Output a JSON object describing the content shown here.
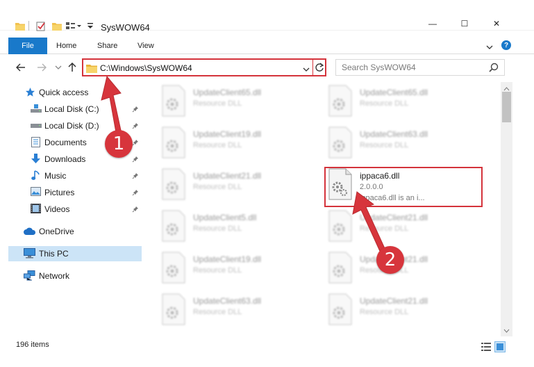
{
  "window": {
    "title": "SysWOW64",
    "minimize_glyph": "—",
    "maximize_glyph": "☐",
    "close_glyph": "✕"
  },
  "ribbon": {
    "tabs": [
      "File",
      "Home",
      "Share",
      "View"
    ],
    "help_glyph": "?"
  },
  "address": {
    "path": "C:\\Windows\\SysWOW64",
    "search_placeholder": "Search SysWOW64"
  },
  "nav": {
    "quick_access": "Quick access",
    "items": [
      "Local Disk (C:)",
      "Local Disk (D:)",
      "Documents",
      "Downloads",
      "Music",
      "Pictures",
      "Videos"
    ],
    "onedrive": "OneDrive",
    "this_pc": "This PC",
    "network": "Network"
  },
  "files": {
    "left": [
      {
        "name": "UpdateClient65.dll",
        "type": "Resource DLL"
      },
      {
        "name": "UpdateClient19.dll",
        "type": "Resource DLL"
      },
      {
        "name": "UpdateClient21.dll",
        "type": "Resource DLL"
      },
      {
        "name": "UpdateClient5.dll",
        "type": "Resource DLL"
      },
      {
        "name": "UpdateClient19.dll",
        "type": "Resource DLL"
      },
      {
        "name": "UpdateClient63.dll",
        "type": "Resource DLL"
      }
    ],
    "right": [
      {
        "name": "UpdateClient65.dll",
        "type": "Resource DLL"
      },
      {
        "name": "UpdateClient63.dll",
        "type": "Resource DLL"
      },
      {
        "name": "ippaca6.dll",
        "type": "2.0.0.0",
        "desc": "ippaca6.dll is an i..."
      },
      {
        "name": "UpdateClient21.dll",
        "type": "Resource DLL"
      },
      {
        "name": "UpdateClient21.dll",
        "type": "Resource DLL"
      },
      {
        "name": "UpdateClient21.dll",
        "type": "Resource DLL"
      }
    ]
  },
  "status": {
    "count": "196 items"
  },
  "callouts": [
    "1",
    "2"
  ],
  "colors": {
    "accent": "#1979ca",
    "highlight_red": "#d4333b",
    "selected_bg": "#cce4f7"
  }
}
